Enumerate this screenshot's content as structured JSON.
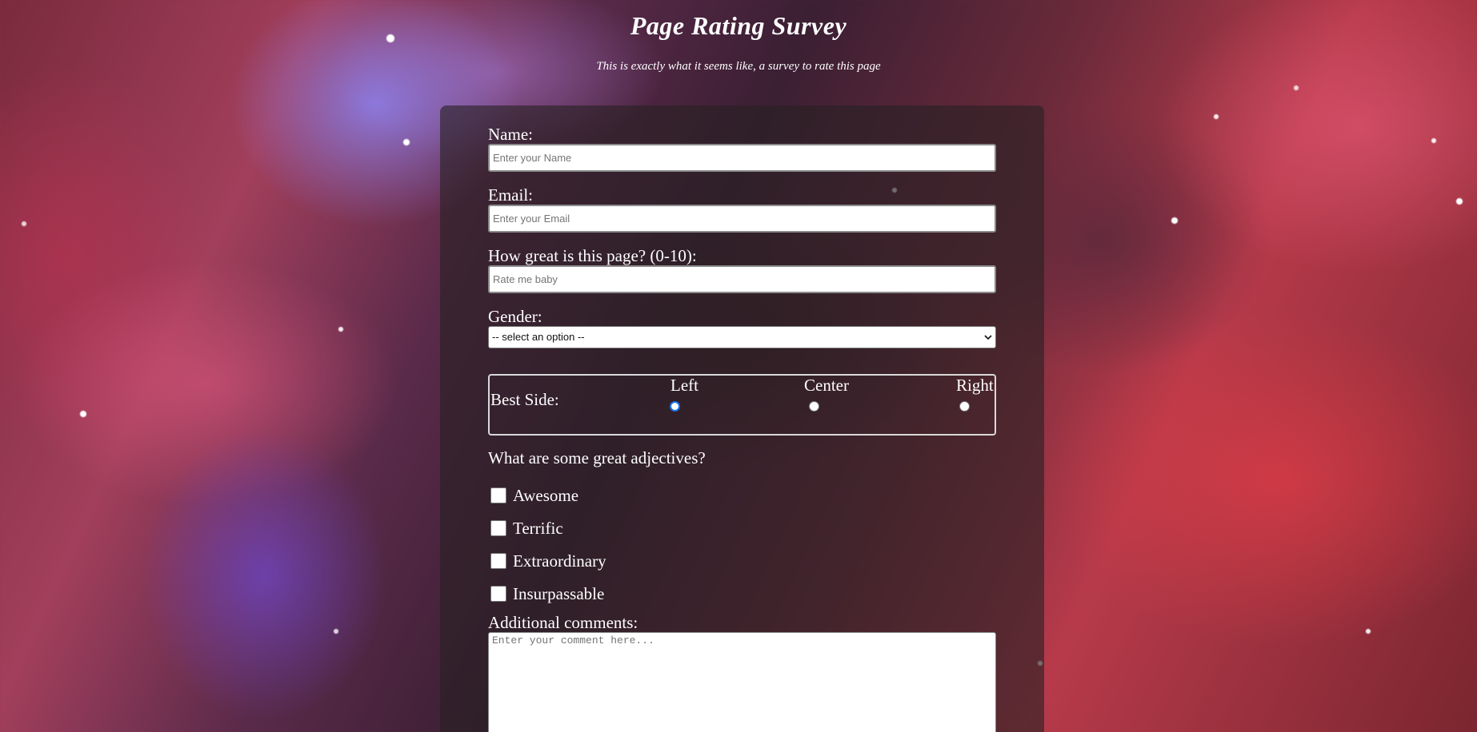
{
  "header": {
    "title": "Page Rating Survey",
    "subtitle": "This is exactly what it seems like, a survey to rate this page"
  },
  "form": {
    "name": {
      "label": "Name:",
      "placeholder": "Enter your Name",
      "value": ""
    },
    "email": {
      "label": "Email:",
      "placeholder": "Enter your Email",
      "value": ""
    },
    "rating": {
      "label": "How great is this page? (0-10):",
      "placeholder": "Rate me baby",
      "value": ""
    },
    "gender": {
      "label": "Gender:",
      "selected": "-- select an option --"
    },
    "best_side": {
      "legend": "Best Side:",
      "options": [
        {
          "label": "Left",
          "checked": true
        },
        {
          "label": "Center",
          "checked": false
        },
        {
          "label": "Right",
          "checked": false
        }
      ]
    },
    "adjectives": {
      "question": "What are some great adjectives?",
      "options": [
        {
          "label": "Awesome",
          "checked": false
        },
        {
          "label": "Terrific",
          "checked": false
        },
        {
          "label": "Extraordinary",
          "checked": false
        },
        {
          "label": "Insurpassable",
          "checked": false
        }
      ]
    },
    "comments": {
      "label": "Additional comments:",
      "placeholder": "Enter your comment here..."
    }
  },
  "colors": {
    "card_background": "#282024",
    "text": "#ffffff",
    "radio_accent": "#1a73e8",
    "input_border": "#8a8a8a"
  }
}
